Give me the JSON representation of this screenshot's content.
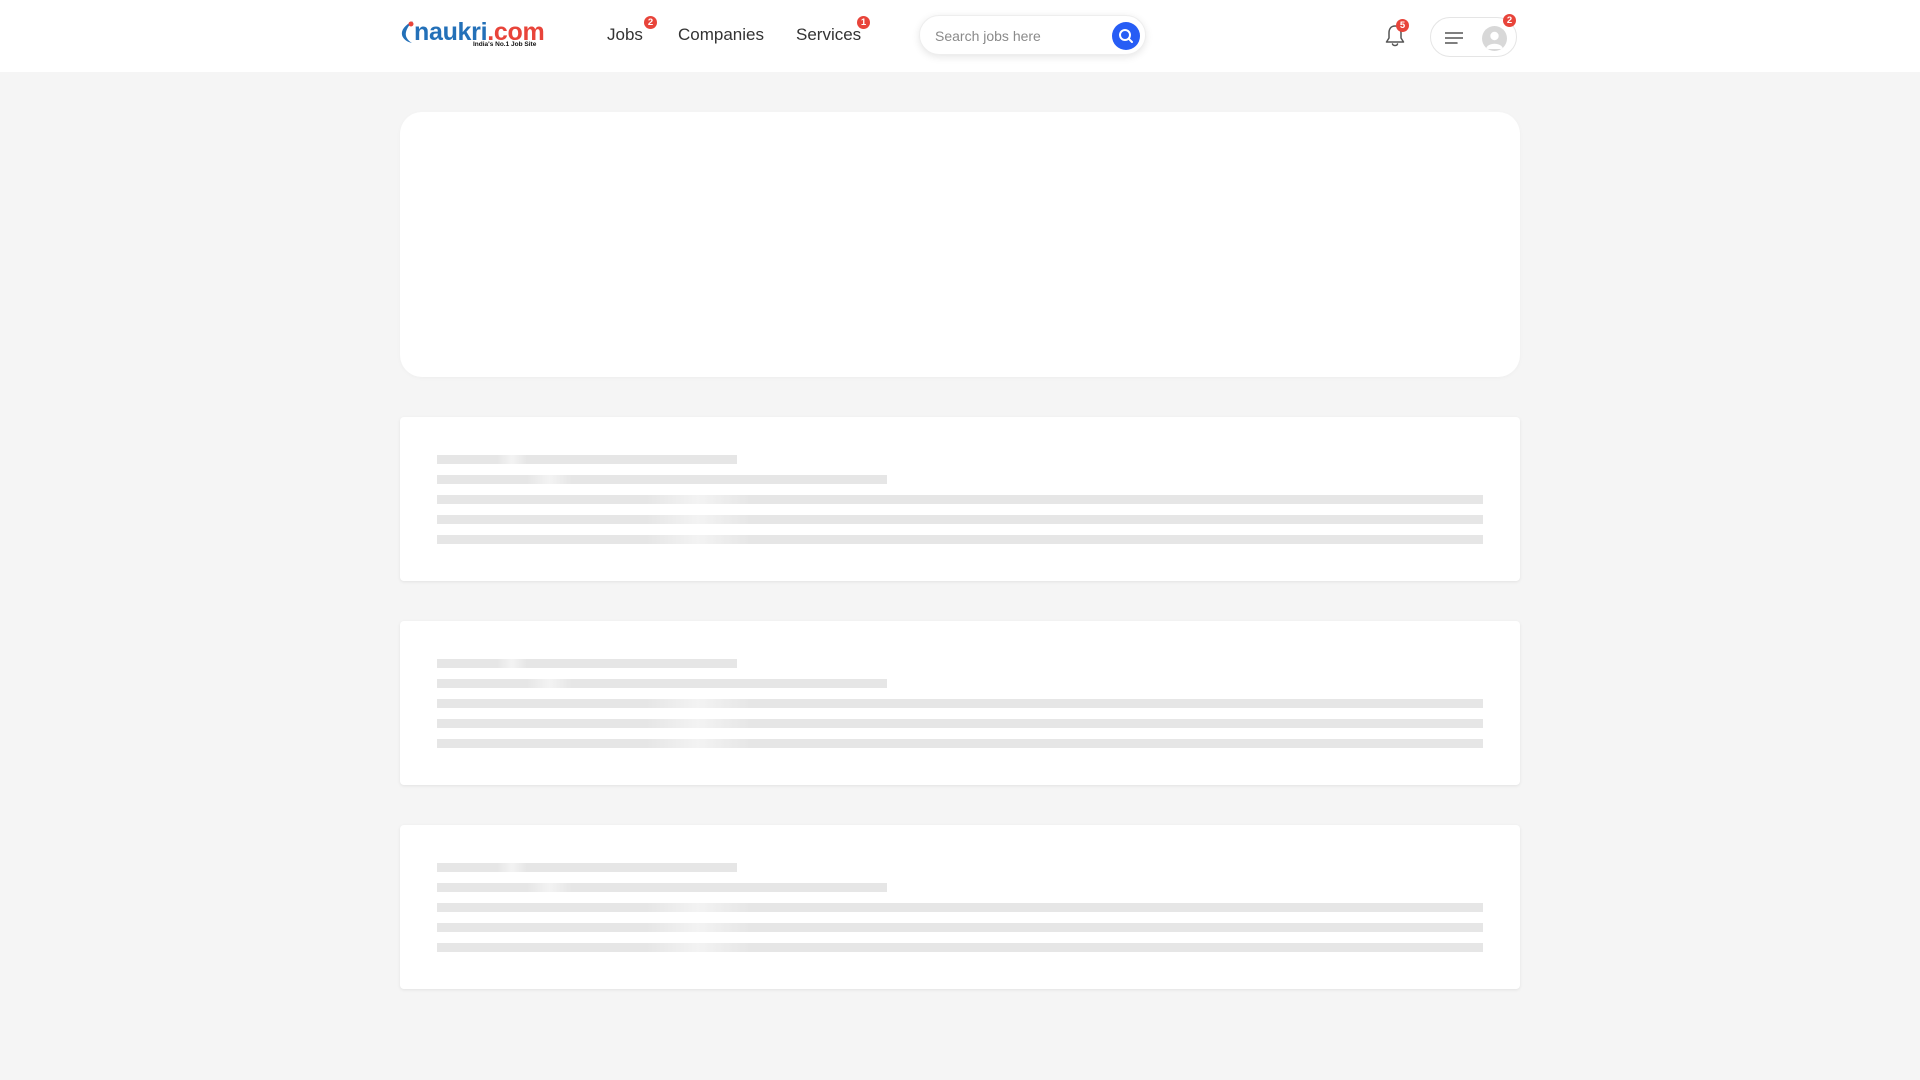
{
  "header": {
    "logo": {
      "name": "naukri",
      "tld": ".com",
      "tagline": "India's No.1 Job Site"
    },
    "nav": [
      {
        "label": "Jobs",
        "badge": "2"
      },
      {
        "label": "Companies"
      },
      {
        "label": "Services",
        "badge": "1"
      }
    ],
    "search": {
      "placeholder": "Search jobs here",
      "value": ""
    },
    "notifications": {
      "icon": "bell-icon",
      "badge": "5"
    },
    "user_menu": {
      "icons": [
        "hamburger-icon",
        "avatar-icon"
      ],
      "badge": "2"
    }
  },
  "colors": {
    "brand_blue": "#2370b8",
    "accent_red": "#e8443a",
    "search_button": "#275df5",
    "page_background": "#f5f5f5",
    "skeleton": "#e6e6e6"
  },
  "main": {
    "skeleton_cards": [
      {
        "state": "loading"
      },
      {
        "state": "loading"
      },
      {
        "state": "loading"
      }
    ]
  }
}
